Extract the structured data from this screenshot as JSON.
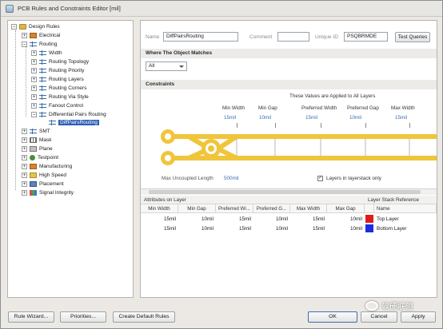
{
  "window": {
    "title": "PCB Rules and Constraints Editor [mil]"
  },
  "tree": {
    "root": "Design Rules",
    "items": [
      {
        "label": "Electrical",
        "icon": "electrical-icon"
      },
      {
        "label": "Routing",
        "icon": "routing-icon"
      },
      {
        "label": "Width",
        "icon": "rule-icon"
      },
      {
        "label": "Routing Topology",
        "icon": "rule-icon"
      },
      {
        "label": "Routing Priority",
        "icon": "rule-icon"
      },
      {
        "label": "Routing Layers",
        "icon": "rule-icon"
      },
      {
        "label": "Routing Corners",
        "icon": "rule-icon"
      },
      {
        "label": "Routing Via Style",
        "icon": "rule-icon"
      },
      {
        "label": "Fanout Control",
        "icon": "rule-icon"
      },
      {
        "label": "Differential Pairs Routing",
        "icon": "rule-icon"
      },
      {
        "label": "DiffPairsRouting",
        "icon": "rule-icon"
      },
      {
        "label": "SMT",
        "icon": "smt-icon"
      },
      {
        "label": "Mask",
        "icon": "mask-icon"
      },
      {
        "label": "Plane",
        "icon": "plane-icon"
      },
      {
        "label": "Testpoint",
        "icon": "testpoint-icon"
      },
      {
        "label": "Manufacturing",
        "icon": "manufacturing-icon"
      },
      {
        "label": "High Speed",
        "icon": "highspeed-icon"
      },
      {
        "label": "Placement",
        "icon": "placement-icon"
      },
      {
        "label": "Signal Integrity",
        "icon": "signal-integrity-icon"
      }
    ]
  },
  "rule": {
    "name_label": "Name",
    "name_value": "DiffPairsRouting",
    "comment_label": "Comment",
    "comment_value": "",
    "uid_label": "Unique ID",
    "uid_value": "PSQBRMDE",
    "test_button": "Test Queries"
  },
  "match": {
    "section_title": "Where The Object Matches",
    "selected": "All"
  },
  "constraints": {
    "section_title": "Constraints",
    "applied_note": "These Values are Applied to All Layers",
    "columns": [
      {
        "label": "Min Width",
        "value": "15mil"
      },
      {
        "label": "Min Gap",
        "value": "10mil"
      },
      {
        "label": "Preferred Width",
        "value": "15mil"
      },
      {
        "label": "Preferred Gap",
        "value": "10mil"
      },
      {
        "label": "Max Width",
        "value": "15mil"
      }
    ],
    "uncoupled_label": "Max Uncoupled Length",
    "uncoupled_value": "500mil",
    "layerstack_checkbox_label": "Layers in layerstack only",
    "layerstack_checked": true
  },
  "layer_table": {
    "group_left": "Attributes on Layer",
    "group_right": "Layer Stack Reference",
    "headers": [
      "Min Width",
      "Min Gap",
      "Preferred Wi...",
      "Preferred G...",
      "Max Width",
      "Max Gap",
      "",
      "Name"
    ],
    "rows": [
      {
        "values": [
          "15mil",
          "10mil",
          "15mil",
          "10mil",
          "15mil",
          "10mil"
        ],
        "color": "#e01b1b",
        "name": "Top Layer"
      },
      {
        "values": [
          "15mil",
          "10mil",
          "15mil",
          "10mil",
          "15mil",
          "10mil"
        ],
        "color": "#1b2ee0",
        "name": "Bottom Layer"
      }
    ]
  },
  "buttons": {
    "rule_wizard": "Rule Wizard...",
    "priorities": "Priorities...",
    "create_default": "Create Default Rules",
    "ok": "OK",
    "cancel": "Cancel",
    "apply": "Apply"
  },
  "watermark": {
    "text": "软硬联盟"
  },
  "colors": {
    "trace": "#f0c53a",
    "accent": "#3a6db0",
    "selection": "#2a5fb5"
  }
}
